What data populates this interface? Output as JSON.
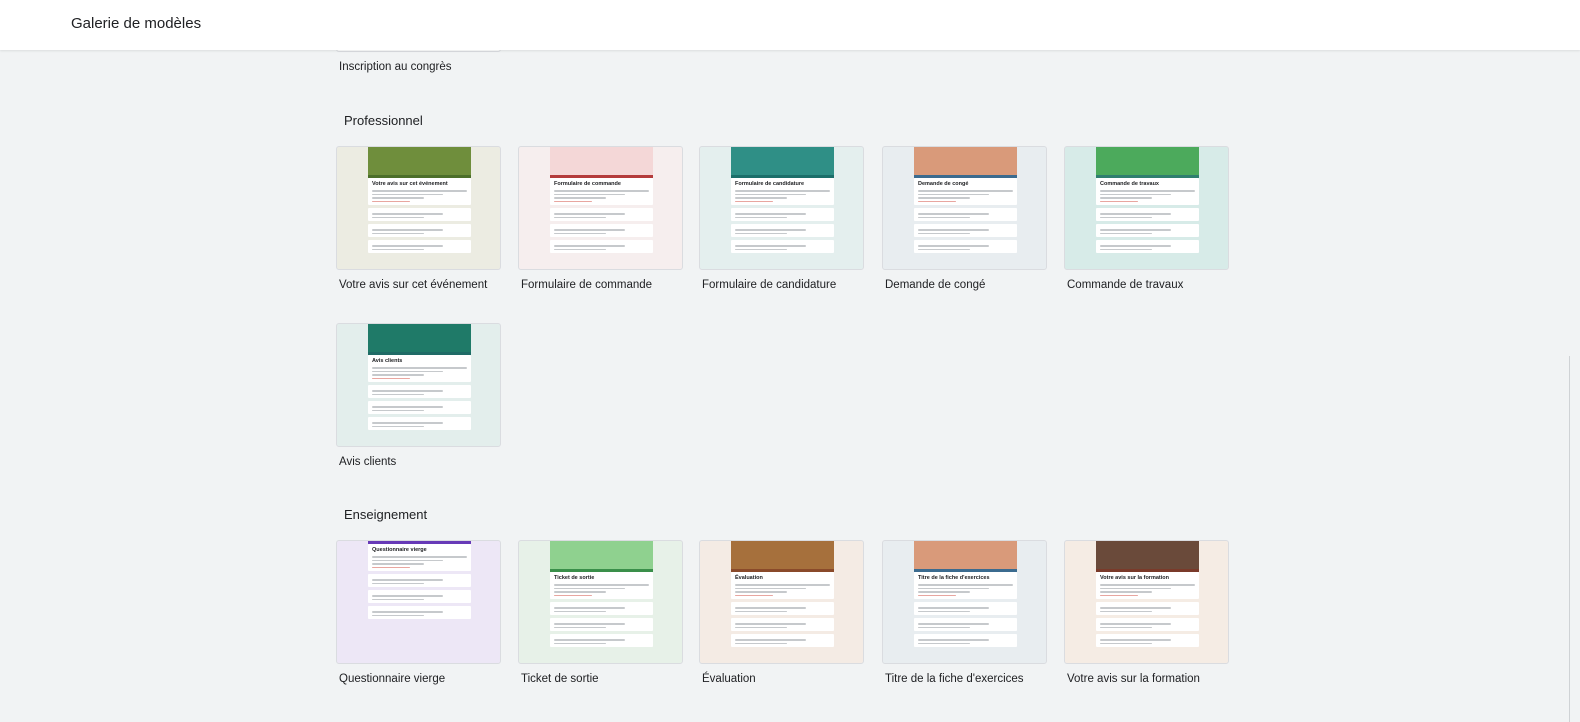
{
  "header": {
    "title": "Galerie de modèles"
  },
  "partial": {
    "label": "Inscription au congrès"
  },
  "sections": [
    {
      "title": "Professionnel",
      "rows": [
        [
          {
            "label": "Votre avis sur cet événement",
            "preview_title": "Votre avis sur cet événement",
            "bg": "#ecece2",
            "accent": "#4c6f2a",
            "banner": "#6f8e3c"
          },
          {
            "label": "Formulaire de commande",
            "preview_title": "Formulaire de commande",
            "bg": "#f6eeee",
            "accent": "#b43b3b",
            "banner": "#f4d7d7"
          },
          {
            "label": "Formulaire de candidature",
            "preview_title": "Formulaire de candidature",
            "bg": "#e4efee",
            "accent": "#1b6f6a",
            "banner": "#2f8f86"
          },
          {
            "label": "Demande de congé",
            "preview_title": "Demande de congé",
            "bg": "#e8edf0",
            "accent": "#3b6b8f",
            "banner": "#d99a7a"
          },
          {
            "label": "Commande de travaux",
            "preview_title": "Commande de travaux",
            "bg": "#d7ebe8",
            "accent": "#2f7f6f",
            "banner": "#4caa5c"
          }
        ],
        [
          {
            "label": "Avis clients",
            "preview_title": "Avis clients",
            "bg": "#e3eeec",
            "accent": "#1f6b66",
            "banner": "#1f7a68"
          }
        ]
      ]
    },
    {
      "title": "Enseignement",
      "rows": [
        [
          {
            "label": "Questionnaire vierge",
            "preview_title": "Questionnaire vierge",
            "bg": "#ede7f6",
            "accent": "#673ab7",
            "banner": ""
          },
          {
            "label": "Ticket de sortie",
            "preview_title": "Ticket de sortie",
            "bg": "#e7f1e8",
            "accent": "#3a8f4a",
            "banner": "#8fd18f"
          },
          {
            "label": "Évaluation",
            "preview_title": "Évaluation",
            "bg": "#f4ebe4",
            "accent": "#8a4a2a",
            "banner": "#a6703c"
          },
          {
            "label": "Titre de la fiche d'exercices",
            "preview_title": "Titre de la fiche d'exercices",
            "bg": "#e8edf0",
            "accent": "#3b6b8f",
            "banner": "#d99a7a"
          },
          {
            "label": "Votre avis sur la formation",
            "preview_title": "Votre avis sur la formation",
            "bg": "#f5ece4",
            "accent": "#7a3a2a",
            "banner": "#6a4a3a"
          }
        ]
      ]
    }
  ]
}
